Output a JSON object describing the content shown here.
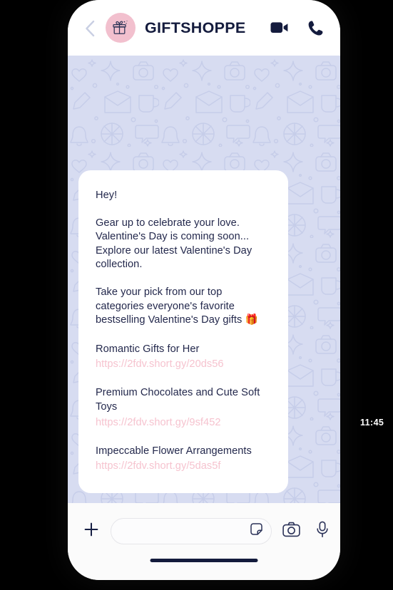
{
  "header": {
    "brand_title": "GIFTSHOPPE",
    "back_icon": "chevron-left-icon",
    "avatar_icon": "gift-box-icon",
    "video_icon": "video-camera-icon",
    "call_icon": "phone-handset-icon",
    "avatar_bg": "#f2c0ce",
    "title_color": "#141b3d"
  },
  "chat": {
    "background_color": "#d7dcf1",
    "doodle_color": "#c8cfe8",
    "bubble_bg": "#ffffff",
    "text_color": "#23284c",
    "link_color": "#f6c3cf",
    "message": {
      "greeting": "Hey!",
      "paragraph_1": "Gear up to celebrate your love. Valentine's Day is coming soon... Explore our latest Valentine's Day collection.",
      "paragraph_2_text": "Take your pick from our top categories everyone's favorite bestselling Valentine's Day gifts ",
      "paragraph_2_emoji": "🎁",
      "links": [
        {
          "title": "Romantic Gifts for Her",
          "url": "https://2fdv.short.gy/20ds56"
        },
        {
          "title": "Premium Chocolates and Cute Soft Toys",
          "url": "https://2fdv.short.gy/9sf452"
        },
        {
          "title": "Impeccable Flower Arrangements",
          "url": "https://2fdv.short.gy/5das5f"
        }
      ]
    }
  },
  "input_bar": {
    "attach_icon": "plus-icon",
    "sticker_icon": "sticker-icon",
    "camera_icon": "camera-icon",
    "mic_icon": "microphone-icon",
    "message_value": "",
    "message_placeholder": ""
  },
  "timestamp": {
    "value": "11:45",
    "color": "#ffffff"
  }
}
